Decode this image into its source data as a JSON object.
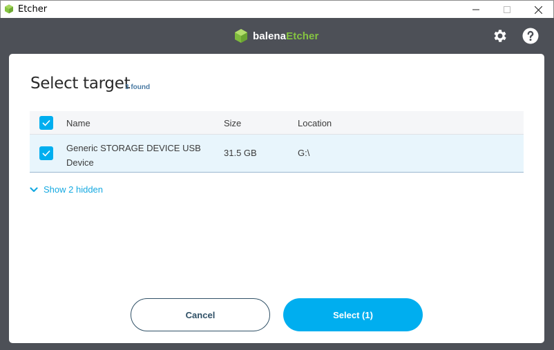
{
  "window": {
    "title": "Etcher"
  },
  "header": {
    "brand_prefix": "balena",
    "brand_suffix": "Etcher",
    "brand_color": "#85c441"
  },
  "icons": {
    "app": "etcher-cube-icon",
    "settings": "gear-icon",
    "help": "question-icon",
    "minimize": "minimize-icon",
    "maximize": "maximize-icon",
    "close": "close-icon"
  },
  "modal": {
    "title": "Select target",
    "found_count": "3 found",
    "table": {
      "headers": [
        "Name",
        "Size",
        "Location"
      ],
      "header_checked": true,
      "rows": [
        {
          "checked": true,
          "name": "Generic STORAGE DEVICE USB Device",
          "size": "31.5 GB",
          "location": "G:\\"
        }
      ]
    },
    "show_hidden_label": "Show 2 hidden",
    "cancel_label": "Cancel",
    "select_label": "Select (1)"
  },
  "colors": {
    "accent": "#00aeef",
    "background": "#4d5057"
  }
}
